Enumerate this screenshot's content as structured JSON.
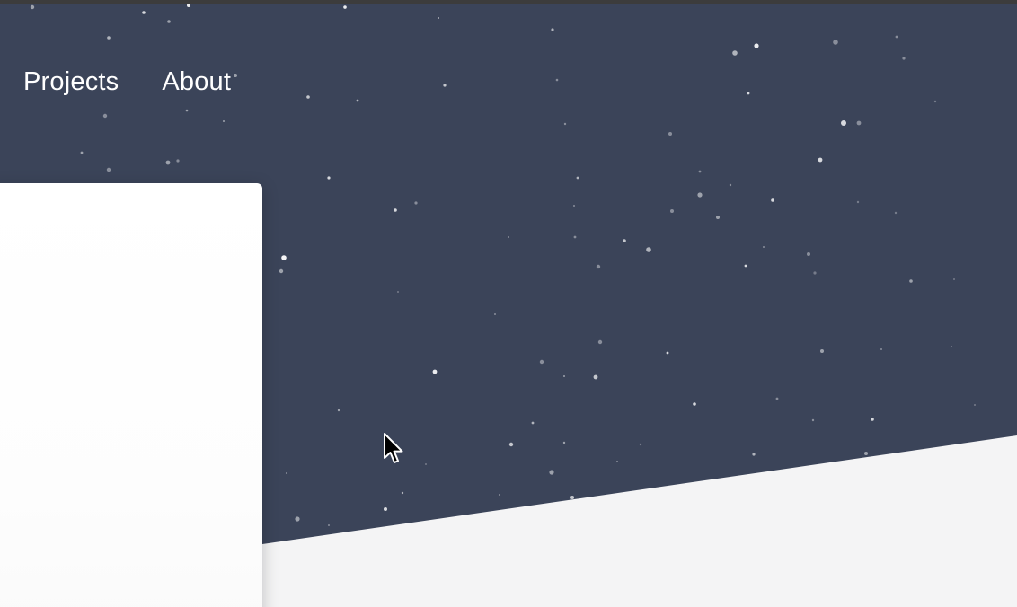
{
  "nav": {
    "items": [
      {
        "label": "Projects"
      },
      {
        "label": "About"
      }
    ]
  },
  "colors": {
    "hero_background": "#3b4459",
    "section_background": "#f4f4f5",
    "card_background": "#ffffff",
    "nav_text": "#ffffff",
    "star": "#ffffff"
  }
}
